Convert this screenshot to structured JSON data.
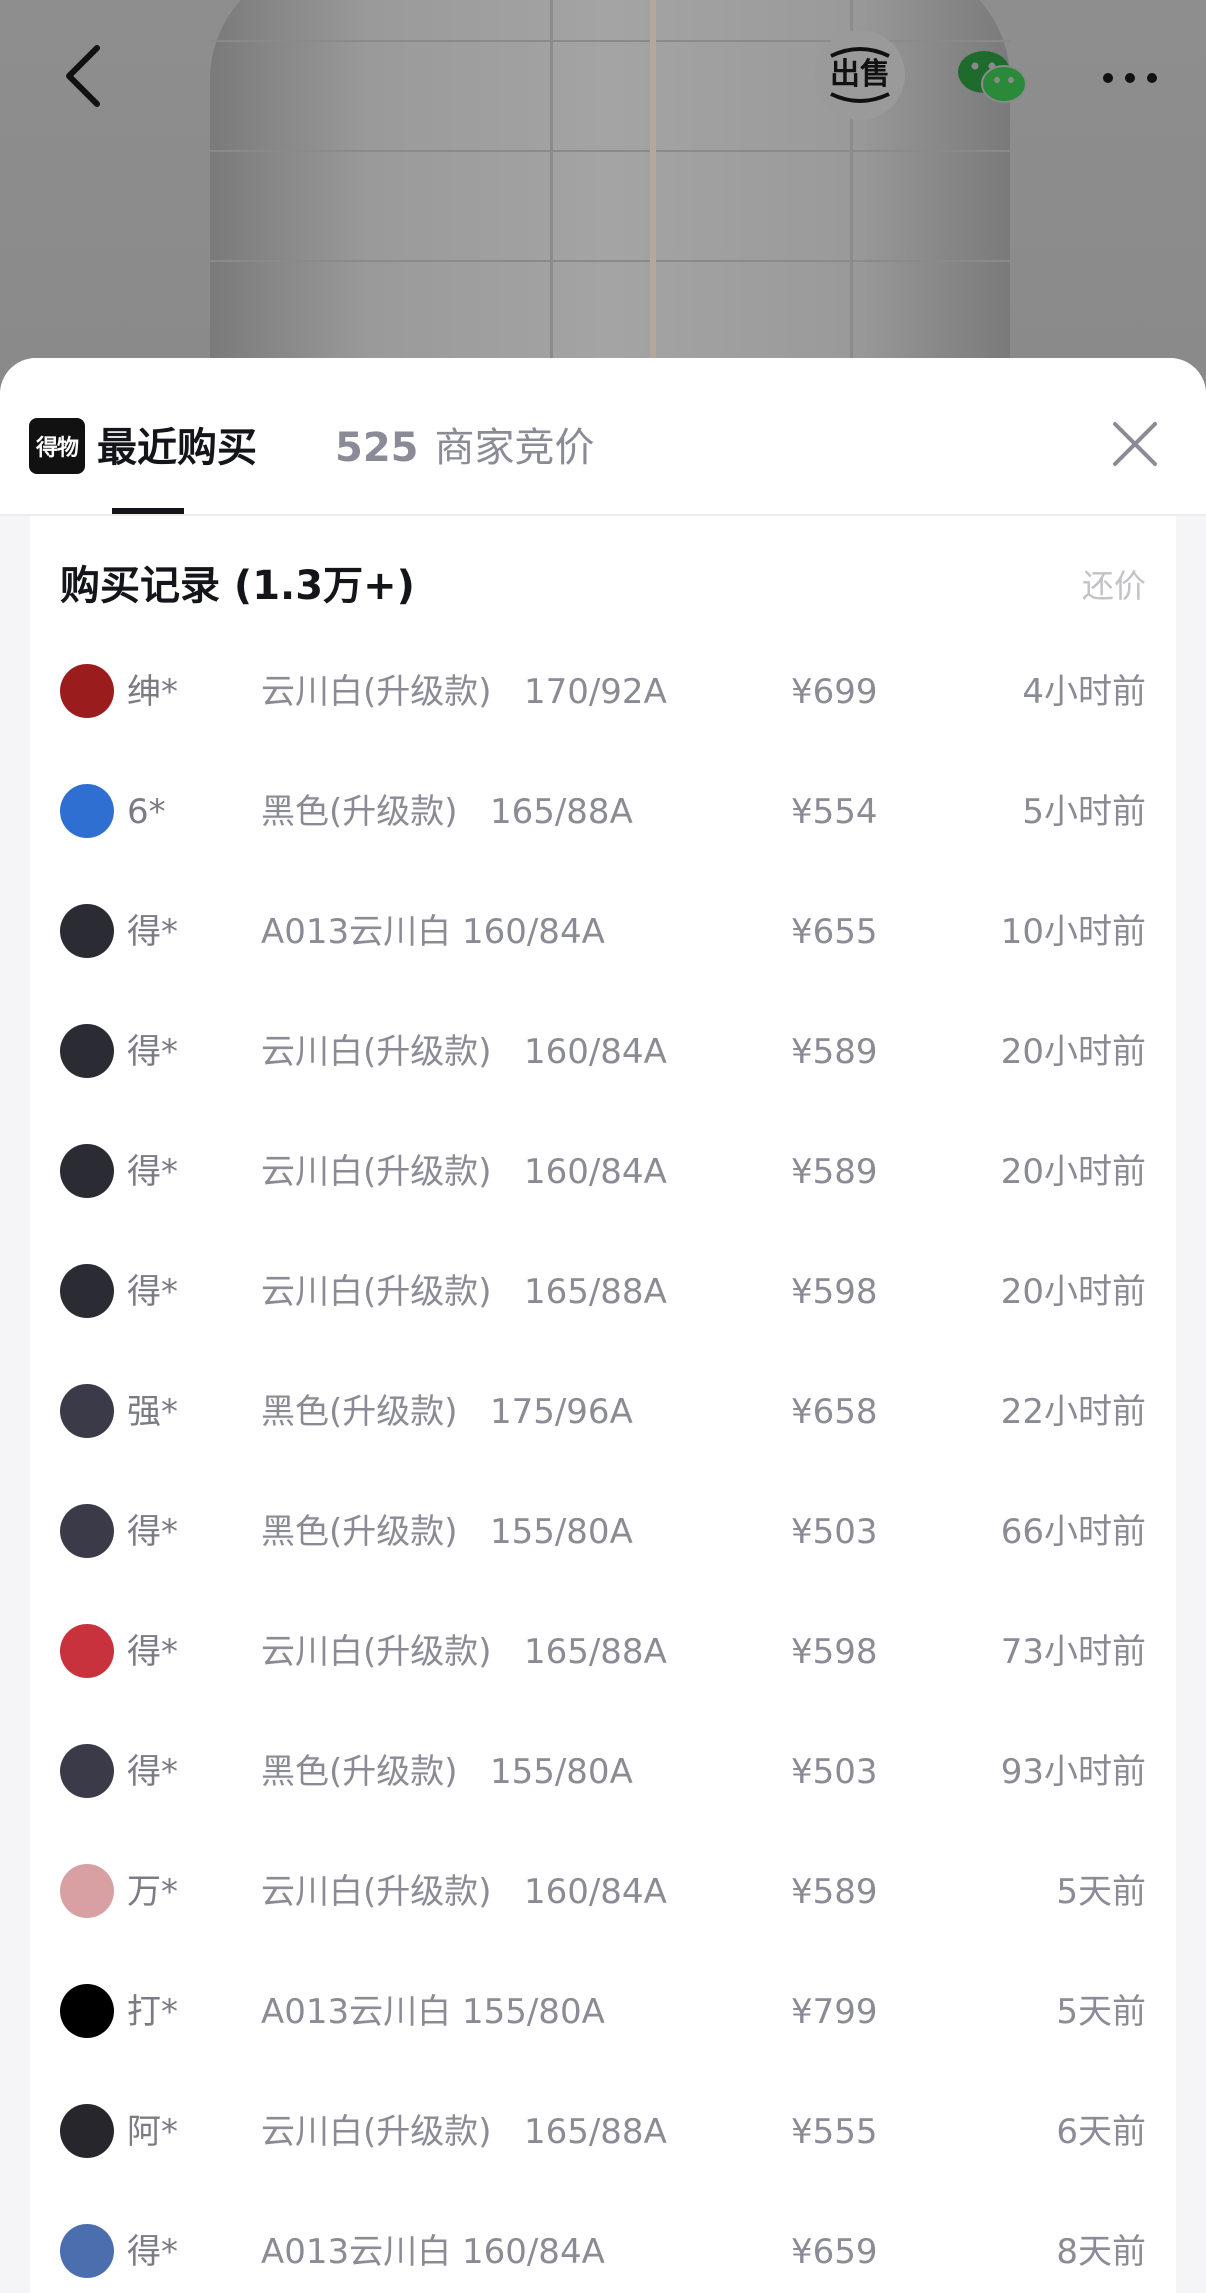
{
  "topbar": {
    "back_icon": "chevron-left-icon",
    "sell_label": "出售",
    "share_icon": "wechat-icon",
    "more_icon": "more-icon"
  },
  "sheet": {
    "brand_logo_text": "得物",
    "tab_recent_label": "最近购买",
    "tab_bids_count": "525",
    "tab_bids_label": "商家竞价",
    "close_icon": "close-icon"
  },
  "records": {
    "title": "购买记录 (1.3万+)",
    "action_label": "还价",
    "rows": [
      {
        "user": "绅*",
        "spec": "云川白(升级款)   170/92A",
        "price": "¥699",
        "time": "4小时前",
        "avatar_color": "#9b1c1c"
      },
      {
        "user": "6*",
        "spec": "黑色(升级款)   165/88A",
        "price": "¥554",
        "time": "5小时前",
        "avatar_color": "#2f6fd1"
      },
      {
        "user": "得*",
        "spec": "A013云川白 160/84A",
        "price": "¥655",
        "time": "10小时前",
        "avatar_color": "#2b2b33"
      },
      {
        "user": "得*",
        "spec": "云川白(升级款)   160/84A",
        "price": "¥589",
        "time": "20小时前",
        "avatar_color": "#2b2b33"
      },
      {
        "user": "得*",
        "spec": "云川白(升级款)   160/84A",
        "price": "¥589",
        "time": "20小时前",
        "avatar_color": "#2b2b33"
      },
      {
        "user": "得*",
        "spec": "云川白(升级款)   165/88A",
        "price": "¥598",
        "time": "20小时前",
        "avatar_color": "#2b2b33"
      },
      {
        "user": "强*",
        "spec": "黑色(升级款)   175/96A",
        "price": "¥658",
        "time": "22小时前",
        "avatar_color": "#3a3a48"
      },
      {
        "user": "得*",
        "spec": "黑色(升级款)   155/80A",
        "price": "¥503",
        "time": "66小时前",
        "avatar_color": "#3a3a48"
      },
      {
        "user": "得*",
        "spec": "云川白(升级款)   165/88A",
        "price": "¥598",
        "time": "73小时前",
        "avatar_color": "#c8323c"
      },
      {
        "user": "得*",
        "spec": "黑色(升级款)   155/80A",
        "price": "¥503",
        "time": "93小时前",
        "avatar_color": "#3a3a48"
      },
      {
        "user": "万*",
        "spec": "云川白(升级款)   160/84A",
        "price": "¥589",
        "time": "5天前",
        "avatar_color": "#d9a0a4"
      },
      {
        "user": "打*",
        "spec": "A013云川白 155/80A",
        "price": "¥799",
        "time": "5天前",
        "avatar_color": "#000000"
      },
      {
        "user": "阿*",
        "spec": "云川白(升级款)   165/88A",
        "price": "¥555",
        "time": "6天前",
        "avatar_color": "#26262c"
      },
      {
        "user": "得*",
        "spec": "A013云川白 160/84A",
        "price": "¥659",
        "time": "8天前",
        "avatar_color": "#4b6fae"
      }
    ]
  }
}
